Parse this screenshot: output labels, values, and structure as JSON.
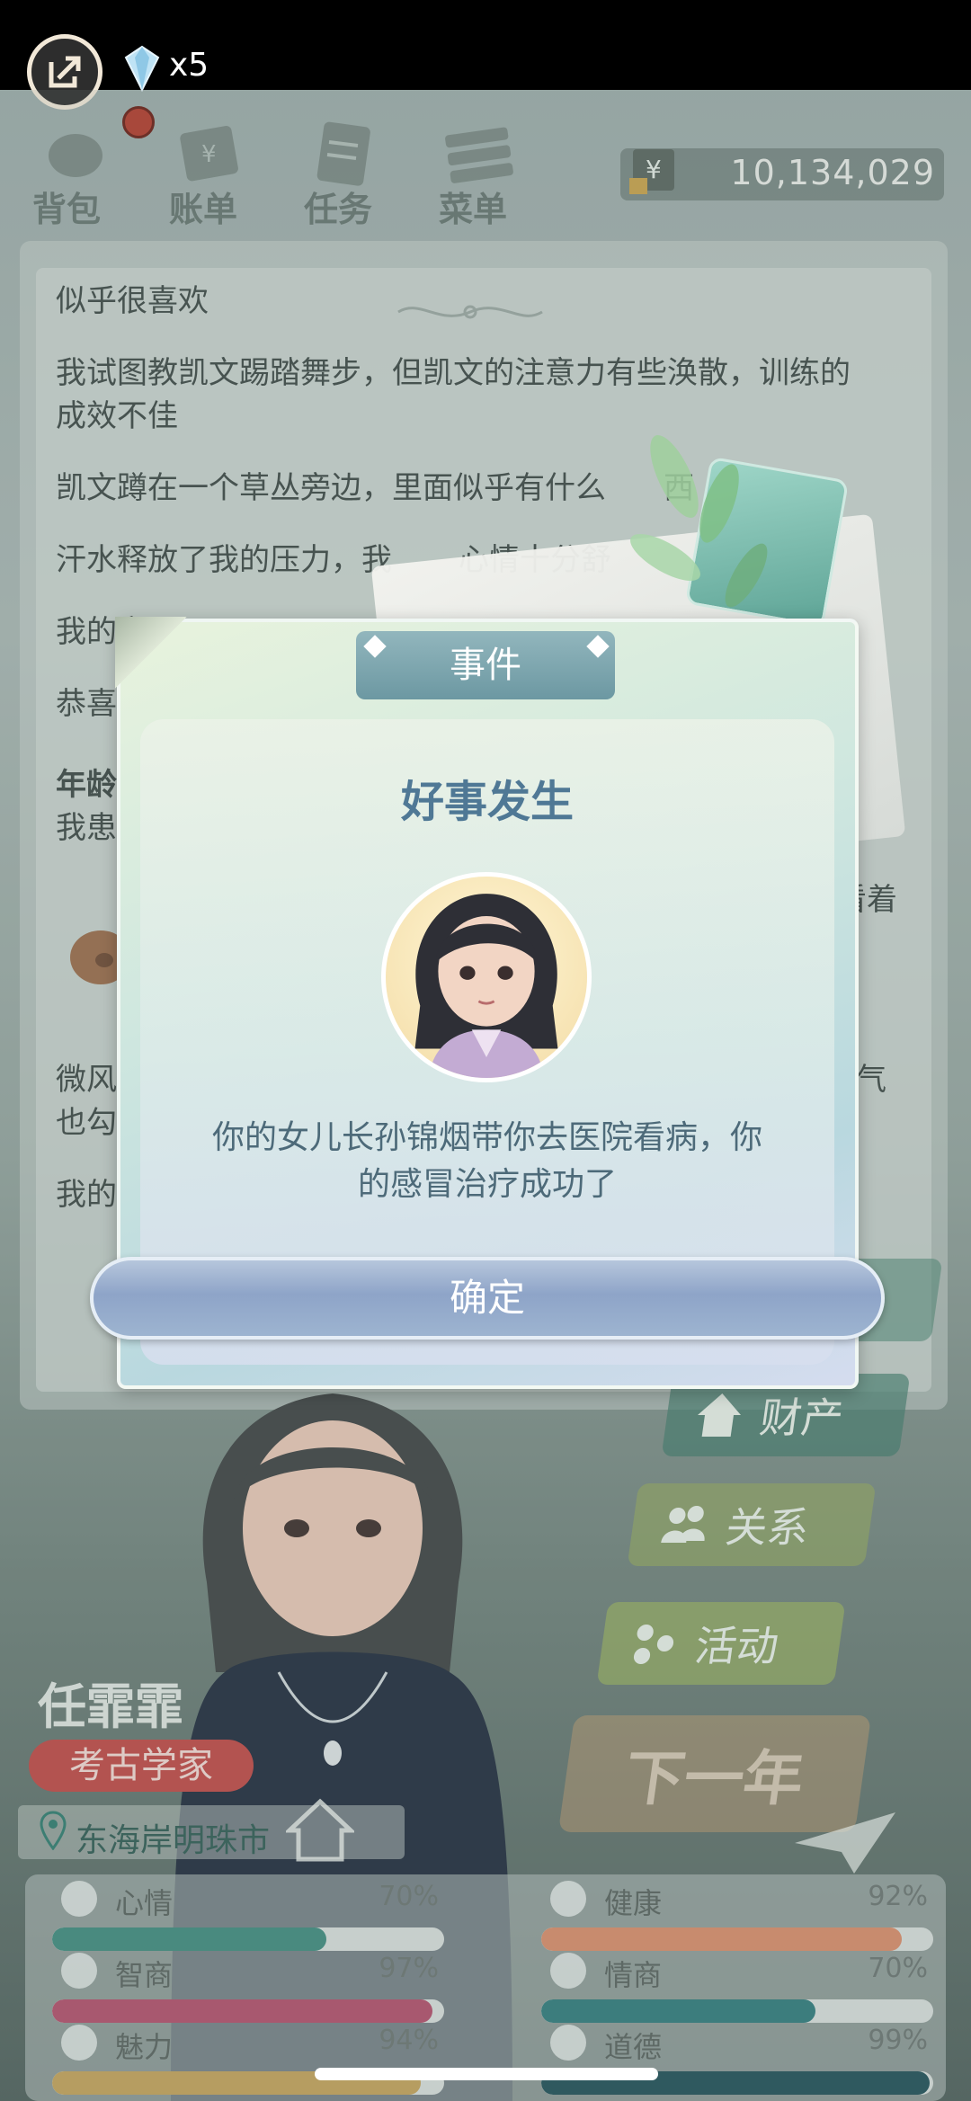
{
  "status": {
    "diamond_count": "x5"
  },
  "nav": {
    "items": [
      {
        "label": "背包",
        "icon": "backpack-icon"
      },
      {
        "label": "账单",
        "icon": "bill-icon"
      },
      {
        "label": "任务",
        "icon": "task-icon"
      },
      {
        "label": "菜单",
        "icon": "menu-icon"
      }
    ],
    "money": "10,134,029",
    "currency_icon": "yen-icon"
  },
  "log": {
    "lines": [
      "似乎很喜欢",
      "我试图教凯文踢踏舞步，但凯文的注意力有些涣散，训练的",
      "成效不佳",
      "凯文蹲在一个草丛旁边，里面似乎有什么",
      "西",
      "汗水释放了我的压力，我",
      "心情十分舒",
      "我的宠",
      "恭喜",
      "年龄",
      "我患",
      "看着",
      "微风",
      "气",
      "也勾",
      "我的"
    ]
  },
  "profile": {
    "name": "任霏霏",
    "job": "考古学家",
    "location": "东海岸明珠市"
  },
  "side_buttons": {
    "assets": "财产",
    "relations": "关系",
    "activity": "活动",
    "next_year": "下一年"
  },
  "stats": [
    {
      "label": "心情",
      "value": "70%",
      "fraction": 0.7,
      "color": "#3f8a7e",
      "icon": "smile-icon"
    },
    {
      "label": "健康",
      "value": "92%",
      "fraction": 0.92,
      "color": "#d98b6a",
      "icon": "heart-icon"
    },
    {
      "label": "智商",
      "value": "97%",
      "fraction": 0.97,
      "color": "#b24d6b",
      "icon": "bulb-icon"
    },
    {
      "label": "情商",
      "value": "70%",
      "fraction": 0.7,
      "color": "#2f7a7c",
      "icon": "apple-icon"
    },
    {
      "label": "魅力",
      "value": "94%",
      "fraction": 0.94,
      "color": "#c4a25a",
      "icon": "sparkle-icon"
    },
    {
      "label": "道德",
      "value": "99%",
      "fraction": 0.99,
      "color": "#1f4f57",
      "icon": "scale-icon"
    }
  ],
  "modal": {
    "tab": "事件",
    "title": "好事发生",
    "message_line1": "你的女儿长孙锦烟带你去医院看病，你",
    "message_line2": "的感冒治疗成功了",
    "confirm": "确定"
  }
}
